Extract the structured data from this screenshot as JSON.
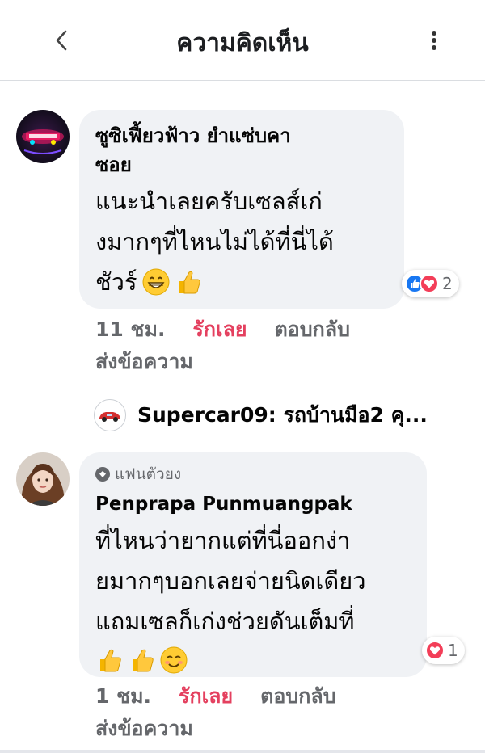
{
  "header": {
    "title": "ความคิดเห็น",
    "back_icon": "chevron-left-icon",
    "more_icon": "more-vertical-icon"
  },
  "comments": [
    {
      "author": "ซูซิเฟี้ยวฟ้าว ยำแซ่บคา ซอย",
      "author_line1": "ซูซิเฟี้ยวฟ้าว ยำแซ่บคา",
      "author_line2": "ซอย",
      "text_line1": "แนะนำเลยครับเซลส์เก่",
      "text_line2": "งมากๆที่ไหนไม่ได้ที่นี่ได้",
      "text_line3": "ชัวร์",
      "emojis": [
        "grinning-face-emoji",
        "thumbs-up-emoji"
      ],
      "reactions": {
        "types": [
          "like",
          "love"
        ],
        "count": "2"
      },
      "actions": {
        "time": "11 ชม.",
        "love": "รักเลย",
        "reply": "ตอบกลับ",
        "message": "ส่งข้อความ"
      }
    },
    {
      "badge": "แฟนตัวยง",
      "author": "Penprapa Punmuangpak",
      "text_line1": "ที่ไหนว่ายากแต่ที่นี่ออกง่า",
      "text_line2": "ยมากๆบอกเลยจ่ายนิดเดียว",
      "text_line3": "แถมเซลก็เก่งช่วยดันเต็มที่",
      "emojis": [
        "thumbs-up-emoji",
        "thumbs-up-emoji",
        "smiling-face-emoji"
      ],
      "reactions": {
        "types": [
          "love"
        ],
        "count": "1"
      },
      "actions": {
        "time": "1 ชม.",
        "love": "รักเลย",
        "reply": "ตอบกลับ",
        "message": "ส่งข้อความ"
      }
    }
  ],
  "reply_preview": {
    "text": "Supercar09: รถบ้านมือ2 คุ..."
  },
  "colors": {
    "bubble": "#f0f2f5",
    "love_action": "#e4405f",
    "meta_text": "#65676b",
    "like": "#1877f2",
    "love": "#f33e58"
  }
}
